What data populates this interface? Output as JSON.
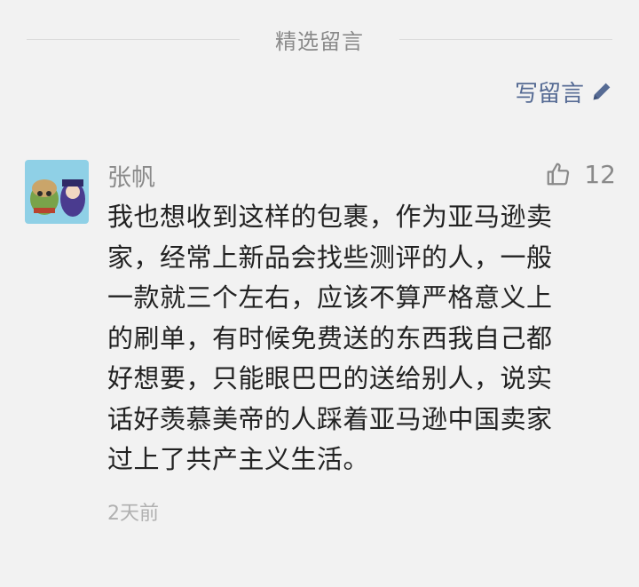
{
  "section": {
    "title": "精选留言",
    "write_label": "写留言"
  },
  "comment": {
    "author": "张帆",
    "like_count": "12",
    "body_lines": [
      "我也想收到这样的包裹，作为亚马逊卖",
      "家，经常上新品会找些测评的人，一般",
      "一款就三个左右，应该不算严格意义上",
      "的刷单，有时候免费送的东西我自己都",
      "好想要，只能眼巴巴的送给别人，说实",
      "话好羡慕美帝的人踩着亚马逊中国卖家",
      "过上了共产主义生活。"
    ],
    "time": "2天前"
  },
  "colors": {
    "background": "#f2f2f2",
    "link": "#566b94",
    "muted": "#8a8a8a",
    "text": "#222222"
  },
  "icons": {
    "write": "pencil-icon",
    "like": "thumbs-up-icon",
    "avatar": "avatar"
  }
}
